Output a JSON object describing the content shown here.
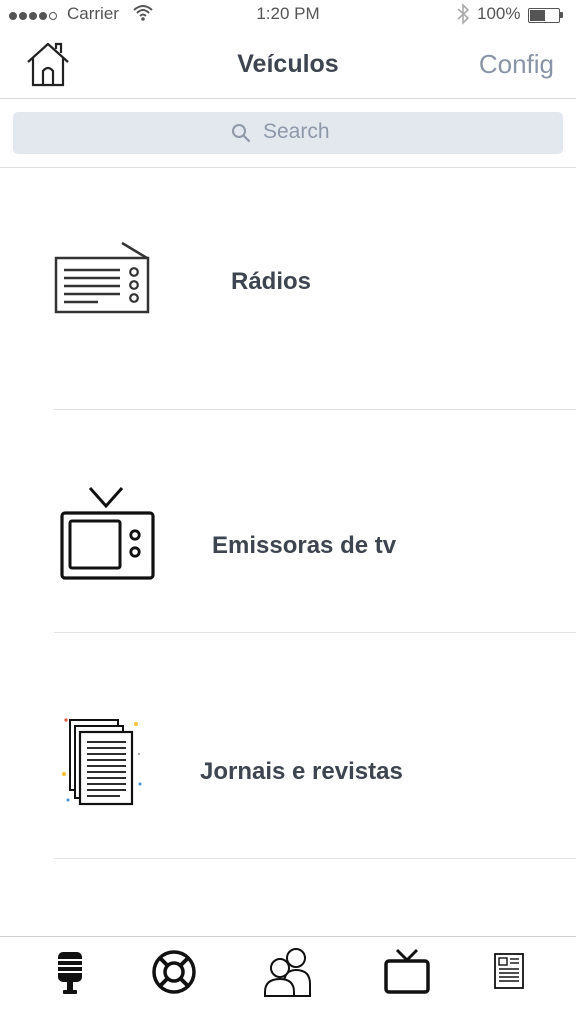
{
  "status_bar": {
    "carrier": "Carrier",
    "time": "1:20 PM",
    "battery": "100%",
    "battery_level": 0.55
  },
  "nav": {
    "title": "Veículos",
    "right_button": "Config"
  },
  "search": {
    "placeholder": "Search"
  },
  "list": {
    "items": [
      {
        "label": "Rádios",
        "icon": "radio-icon"
      },
      {
        "label": "Emissoras de tv",
        "icon": "tv-icon"
      },
      {
        "label": "Jornais e revistas",
        "icon": "newspaper-stack-icon"
      }
    ]
  },
  "tab_bar": {
    "items": [
      {
        "icon": "microphone-icon"
      },
      {
        "icon": "lifebuoy-icon"
      },
      {
        "icon": "people-icon"
      },
      {
        "icon": "tv-icon"
      },
      {
        "icon": "newspaper-icon"
      }
    ]
  },
  "colors": {
    "title": "#3e4550",
    "config": "#8a94a6",
    "search_bg": "#e3e8ef"
  }
}
